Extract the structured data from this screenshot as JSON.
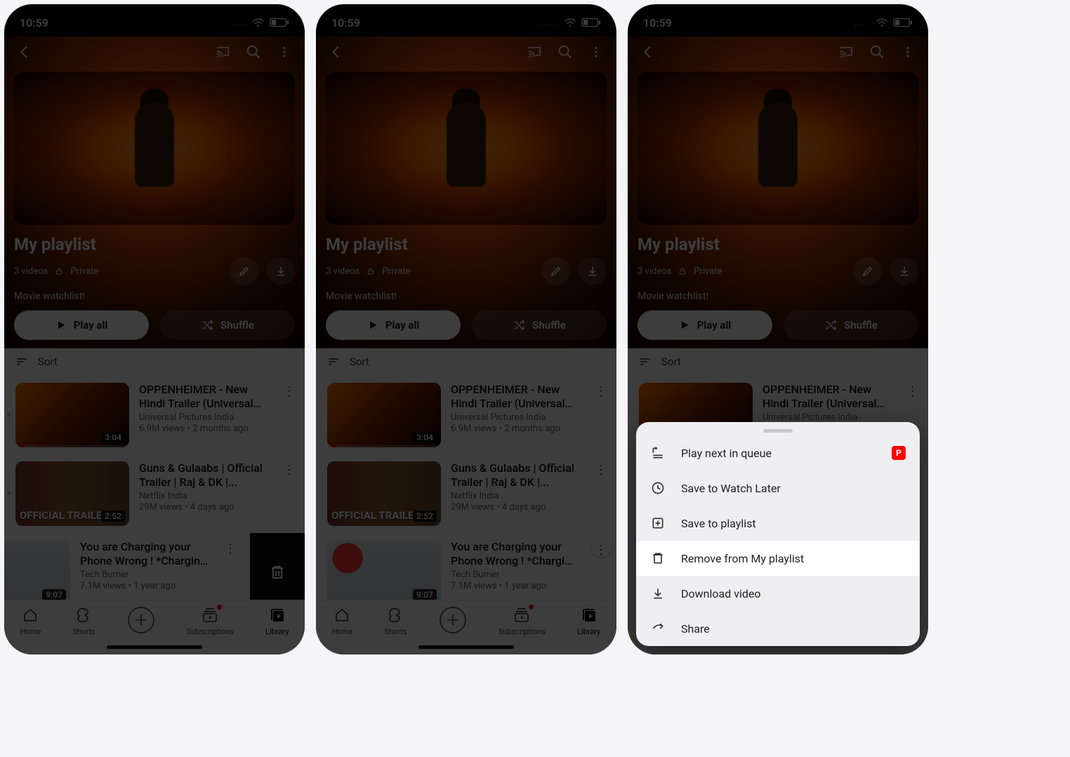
{
  "status": {
    "time": "10:59"
  },
  "playlist": {
    "title": "My playlist",
    "video_count": "3 videos",
    "privacy": "Private",
    "description": "Movie watchlist!",
    "play_all": "Play all",
    "shuffle": "Shuffle",
    "sort": "Sort"
  },
  "videos": [
    {
      "title": "OPPENHEIMER - New Hindi Trailer (Universal Pictures...",
      "channel": "Universal Pictures India",
      "stats": "6.9M views • 2 months ago",
      "duration": "3:04"
    },
    {
      "title": "Guns & Gulaabs | Official Trailer | Raj & DK |...",
      "channel": "Netflix India",
      "stats": "29M views • 4 days ago",
      "duration": "2:52",
      "thumb_badge": "OFFICIAL\nTRAILER"
    },
    {
      "title": "You are Charging your Phone Wrong ! *Charging Tricks*",
      "channel": "Tech Burner",
      "stats": "7.1M views • 1 year ago",
      "duration": "9:07"
    }
  ],
  "nav": {
    "home": "Home",
    "shorts": "Shorts",
    "subscriptions": "Subscriptions",
    "library": "Library"
  },
  "sheet": {
    "play_next": "Play next in queue",
    "watch_later": "Save to Watch Later",
    "save_playlist": "Save to playlist",
    "remove": "Remove from My playlist",
    "download": "Download video",
    "share": "Share",
    "premium_badge": "P"
  }
}
